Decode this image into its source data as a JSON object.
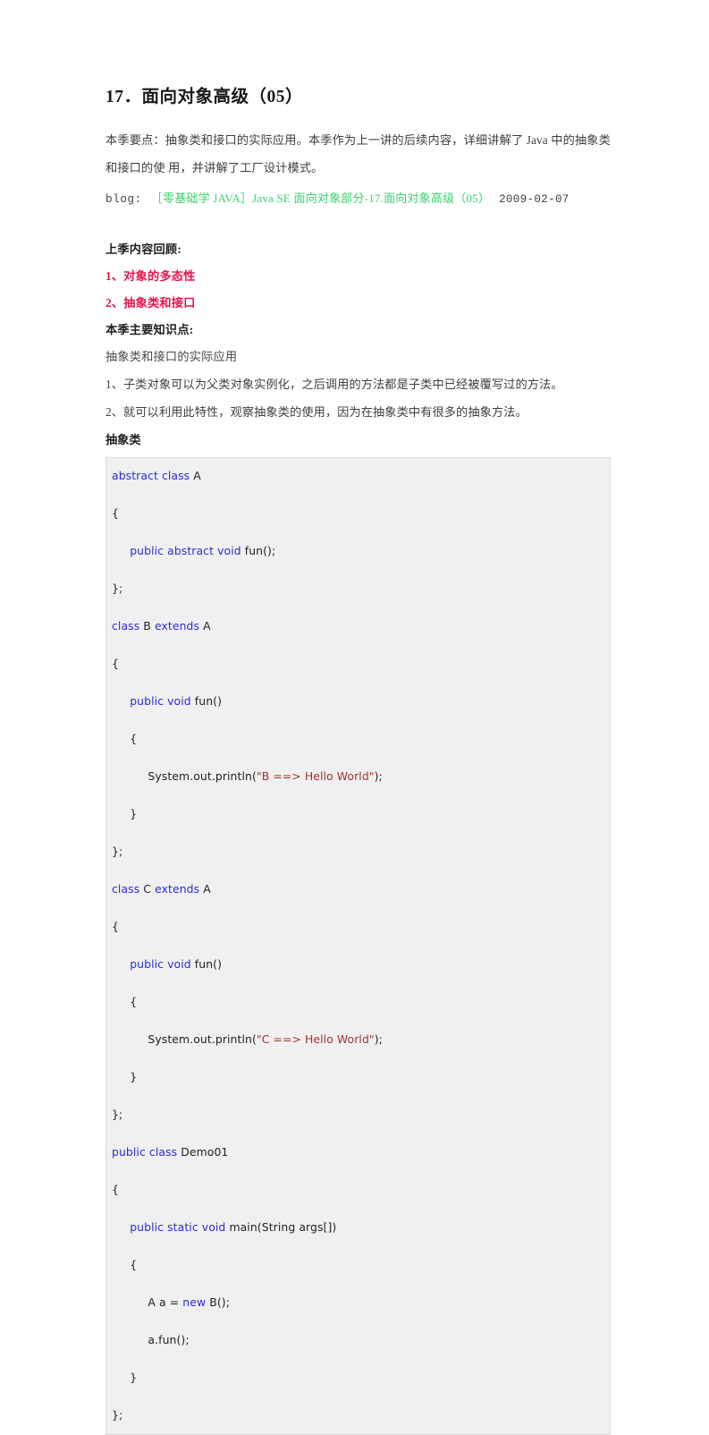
{
  "document": {
    "title": "17．面向对象高级（05）",
    "intro_paragraph": "本季要点：抽象类和接口的实际应用。本季作为上一讲的后续内容，详细讲解了 Java 中的抽象类和接口的使 用，并讲解了工厂设计模式。",
    "blog": {
      "label": "blog:",
      "link_text": "［零基础学 JAVA］Java SE 面向对象部分-17.面向对象高级（05）",
      "date": "2009-02-07",
      "link_color": "#3bd16f"
    },
    "review": {
      "heading": "上季内容回顾:",
      "items": [
        "1、对象的多态性",
        "2、抽象类和接口"
      ],
      "item_color": "#e8144b"
    },
    "knowledge": {
      "heading": "本季主要知识点:",
      "subtitle": "抽象类和接口的实际应用",
      "points": [
        "1、子类对象可以为父类对象实例化，之后调用的方法都是子类中已经被覆写过的方法。",
        "2、就可以利用此特性，观察抽象类的使用，因为在抽象类中有很多的抽象方法。"
      ]
    },
    "code_section": {
      "label": "抽象类",
      "background": "#f0f0f0",
      "border_color": "#dcdcdc",
      "keyword_color": "#2c2ccc",
      "string_color": "#a33030",
      "plain_color": "#222222",
      "lines": [
        [
          {
            "t": "abstract class",
            "c": "kw"
          },
          {
            "t": " A",
            "c": "pl"
          }
        ],
        [
          {
            "t": "{",
            "c": "pl"
          }
        ],
        [
          {
            "t": "     ",
            "c": "pl"
          },
          {
            "t": "public abstract void",
            "c": "kw"
          },
          {
            "t": " fun();",
            "c": "pl"
          }
        ],
        [
          {
            "t": "};",
            "c": "pl"
          }
        ],
        [
          {
            "t": "class",
            "c": "kw"
          },
          {
            "t": " B ",
            "c": "pl"
          },
          {
            "t": "extends",
            "c": "kw"
          },
          {
            "t": " A",
            "c": "pl"
          }
        ],
        [
          {
            "t": "{",
            "c": "pl"
          }
        ],
        [
          {
            "t": "     ",
            "c": "pl"
          },
          {
            "t": "public void",
            "c": "kw"
          },
          {
            "t": " fun()",
            "c": "pl"
          }
        ],
        [
          {
            "t": "     {",
            "c": "pl"
          }
        ],
        [
          {
            "t": "          System.out.println(",
            "c": "pl"
          },
          {
            "t": "\"B ==> Hello World\"",
            "c": "str"
          },
          {
            "t": ");",
            "c": "pl"
          }
        ],
        [
          {
            "t": "     }",
            "c": "pl"
          }
        ],
        [
          {
            "t": "};",
            "c": "pl"
          }
        ],
        [
          {
            "t": "class",
            "c": "kw"
          },
          {
            "t": " C ",
            "c": "pl"
          },
          {
            "t": "extends",
            "c": "kw"
          },
          {
            "t": " A",
            "c": "pl"
          }
        ],
        [
          {
            "t": "{",
            "c": "pl"
          }
        ],
        [
          {
            "t": "     ",
            "c": "pl"
          },
          {
            "t": "public void",
            "c": "kw"
          },
          {
            "t": " fun()",
            "c": "pl"
          }
        ],
        [
          {
            "t": "     {",
            "c": "pl"
          }
        ],
        [
          {
            "t": "          System.out.println(",
            "c": "pl"
          },
          {
            "t": "\"C ==> Hello World\"",
            "c": "str"
          },
          {
            "t": ");",
            "c": "pl"
          }
        ],
        [
          {
            "t": "     }",
            "c": "pl"
          }
        ],
        [
          {
            "t": "};",
            "c": "pl"
          }
        ],
        [
          {
            "t": "public class",
            "c": "kw"
          },
          {
            "t": " Demo01",
            "c": "pl"
          }
        ],
        [
          {
            "t": "{",
            "c": "pl"
          }
        ],
        [
          {
            "t": "     ",
            "c": "pl"
          },
          {
            "t": "public static void",
            "c": "kw"
          },
          {
            "t": " main(String args[])",
            "c": "pl"
          }
        ],
        [
          {
            "t": "     {",
            "c": "pl"
          }
        ],
        [
          {
            "t": "          A a = ",
            "c": "pl"
          },
          {
            "t": "new",
            "c": "kw"
          },
          {
            "t": " B();",
            "c": "pl"
          }
        ],
        [
          {
            "t": "          a.fun();",
            "c": "pl"
          }
        ],
        [
          {
            "t": "     }",
            "c": "pl"
          }
        ],
        [
          {
            "t": "};",
            "c": "pl"
          }
        ]
      ]
    }
  }
}
